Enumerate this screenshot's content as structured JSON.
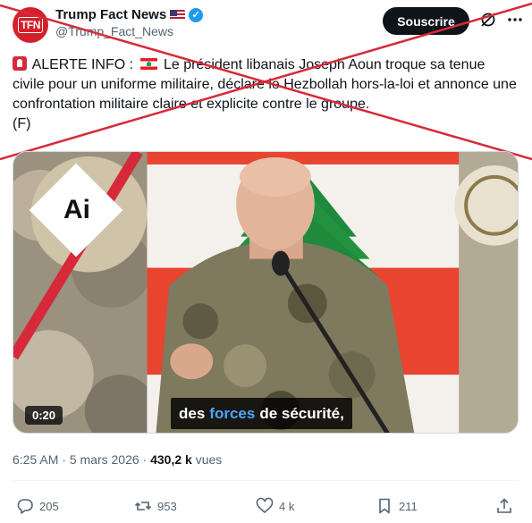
{
  "author": {
    "display_name": "Trump Fact News",
    "handle": "@Trump_Fact_News",
    "avatar_text": "TFN",
    "verified": true
  },
  "header": {
    "subscribe_label": "Souscrire"
  },
  "tweet": {
    "prefix": "ALERTE INFO :",
    "body": "Le président libanais Joseph Aoun troque sa tenue civile pour un uniforme militaire, déclare le Hezbollah hors-la-loi et annonce une confrontation militaire claire et explicite contre le groupe.",
    "suffix": "(F)"
  },
  "media": {
    "ai_badge": "Ai",
    "duration": "0:20",
    "subtitle_before": "des",
    "subtitle_highlight": "forces",
    "subtitle_after": "de sécurité,"
  },
  "meta": {
    "time": "6:25 AM",
    "separator": " · ",
    "date": "5 mars 2026",
    "views_count": "430,2 k",
    "views_label": "vues"
  },
  "actions": {
    "replies": "205",
    "reposts": "953",
    "likes": "4 k",
    "bookmarks": "211"
  },
  "colors": {
    "brand_red": "#d4202a",
    "verified_blue": "#1d9bf0",
    "cross_red": "#d62a3a",
    "subtitle_highlight": "#4aa7ff"
  }
}
